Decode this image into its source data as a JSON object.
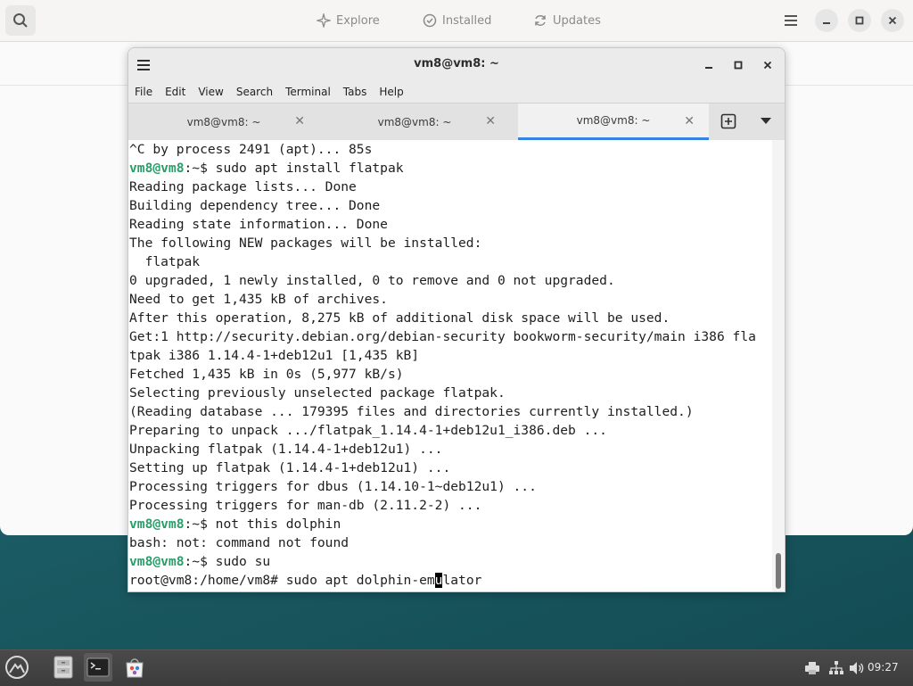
{
  "background_app": {
    "tabs": [
      {
        "label": "Explore",
        "icon": "explore-icon"
      },
      {
        "label": "Installed",
        "icon": "installed-icon"
      },
      {
        "label": "Updates",
        "icon": "updates-icon"
      }
    ]
  },
  "terminal": {
    "title": "vm8@vm8: ~",
    "menu": [
      "File",
      "Edit",
      "View",
      "Search",
      "Terminal",
      "Tabs",
      "Help"
    ],
    "tabs": [
      {
        "label": "vm8@vm8: ~"
      },
      {
        "label": "vm8@vm8: ~"
      },
      {
        "label": "vm8@vm8: ~"
      }
    ],
    "active_tab": 2,
    "prompt_user": "vm8@vm8",
    "prompt_suffix": ":~$ ",
    "lines": [
      {
        "kind": "out",
        "text": "^C by process 2491 (apt)... 85s"
      },
      {
        "kind": "cmd",
        "text": "sudo apt install flatpak"
      },
      {
        "kind": "out",
        "text": "Reading package lists... Done"
      },
      {
        "kind": "out",
        "text": "Building dependency tree... Done"
      },
      {
        "kind": "out",
        "text": "Reading state information... Done"
      },
      {
        "kind": "out",
        "text": "The following NEW packages will be installed:"
      },
      {
        "kind": "out",
        "text": "  flatpak"
      },
      {
        "kind": "out",
        "text": "0 upgraded, 1 newly installed, 0 to remove and 0 not upgraded."
      },
      {
        "kind": "out",
        "text": "Need to get 1,435 kB of archives."
      },
      {
        "kind": "out",
        "text": "After this operation, 8,275 kB of additional disk space will be used."
      },
      {
        "kind": "out",
        "text": "Get:1 http://security.debian.org/debian-security bookworm-security/main i386 fla"
      },
      {
        "kind": "out",
        "text": "tpak i386 1.14.4-1+deb12u1 [1,435 kB]"
      },
      {
        "kind": "out",
        "text": "Fetched 1,435 kB in 0s (5,977 kB/s)"
      },
      {
        "kind": "out",
        "text": "Selecting previously unselected package flatpak."
      },
      {
        "kind": "out",
        "text": "(Reading database ... 179395 files and directories currently installed.)"
      },
      {
        "kind": "out",
        "text": "Preparing to unpack .../flatpak_1.14.4-1+deb12u1_i386.deb ..."
      },
      {
        "kind": "out",
        "text": "Unpacking flatpak (1.14.4-1+deb12u1) ..."
      },
      {
        "kind": "out",
        "text": "Setting up flatpak (1.14.4-1+deb12u1) ..."
      },
      {
        "kind": "out",
        "text": "Processing triggers for dbus (1.14.10-1~deb12u1) ..."
      },
      {
        "kind": "out",
        "text": "Processing triggers for man-db (2.11.2-2) ..."
      },
      {
        "kind": "cmd",
        "text": "not this dolphin"
      },
      {
        "kind": "out",
        "text": "bash: not: command not found"
      },
      {
        "kind": "cmd",
        "text": "sudo su"
      }
    ],
    "root_input": {
      "prompt": "root@vm8:/home/vm8# ",
      "before_cursor": "sudo apt dolphin-em",
      "cursor_char": "u",
      "after_cursor": "lator"
    }
  },
  "taskbar": {
    "clock": "09:27"
  },
  "colors": {
    "accent": "#3584e4",
    "prompt_green": "#2a9d69",
    "desktop": "#1c5e66"
  }
}
